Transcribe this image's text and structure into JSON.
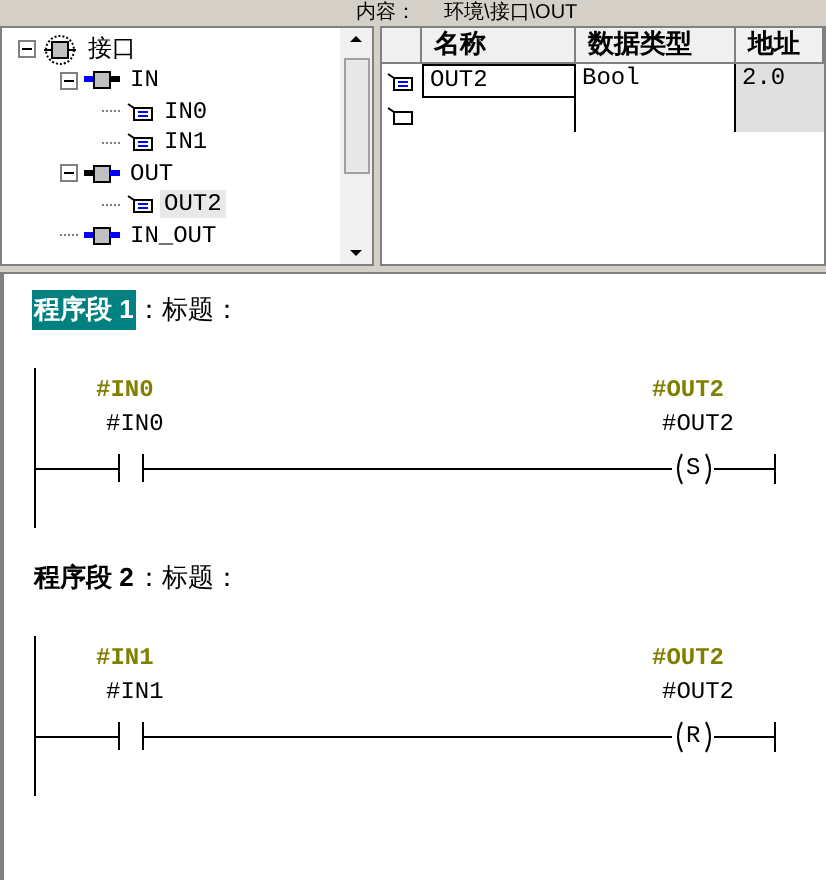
{
  "header": {
    "label": "内容：",
    "path": "环境\\接口\\OUT"
  },
  "tree": [
    {
      "label": "接口",
      "kind": "root",
      "expanded": true,
      "children": [
        {
          "label": "IN",
          "kind": "in",
          "expanded": true,
          "children": [
            {
              "label": "IN0",
              "kind": "var",
              "selected": false
            },
            {
              "label": "IN1",
              "kind": "var",
              "selected": false
            }
          ]
        },
        {
          "label": "OUT",
          "kind": "out",
          "expanded": true,
          "children": [
            {
              "label": "OUT2",
              "kind": "var",
              "selected": true
            }
          ]
        },
        {
          "label": "IN_OUT",
          "kind": "inout"
        }
      ]
    }
  ],
  "table": {
    "columns": [
      "名称",
      "数据类型",
      "地址"
    ],
    "rows": [
      {
        "kind": "var",
        "cells": [
          "OUT2",
          "Bool",
          "2.0"
        ],
        "focused": true
      },
      {
        "kind": "new"
      }
    ]
  },
  "networks": [
    {
      "label": "程序段 1",
      "title": "：标题：",
      "selected": true,
      "contact": {
        "symbol": "#IN0",
        "operand": "#IN0"
      },
      "coil": {
        "symbol": "#OUT2",
        "operand": "#OUT2",
        "letter": "S"
      }
    },
    {
      "label": "程序段 2",
      "title": "：标题：",
      "selected": false,
      "contact": {
        "symbol": "#IN1",
        "operand": "#IN1"
      },
      "coil": {
        "symbol": "#OUT2",
        "operand": "#OUT2",
        "letter": "R"
      }
    }
  ]
}
